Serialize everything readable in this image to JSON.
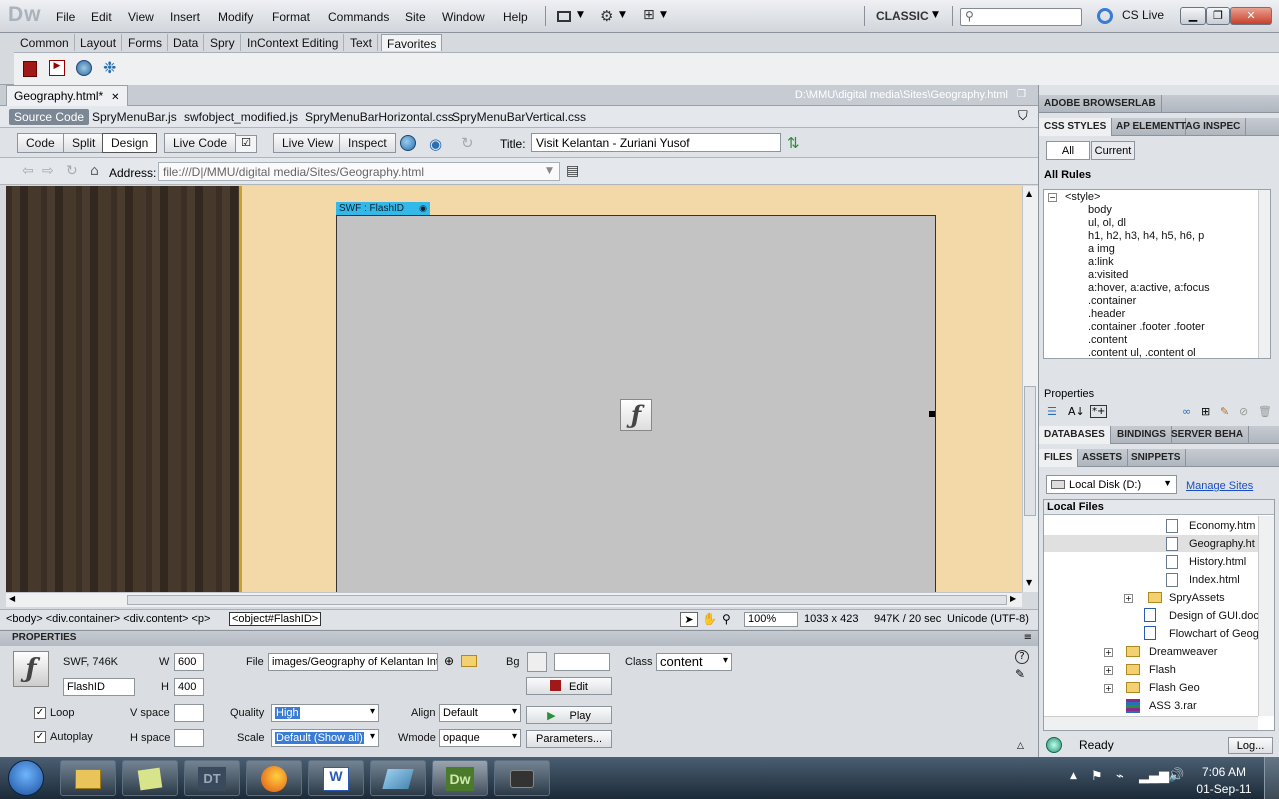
{
  "app": {
    "logo": "Dw",
    "workspace": "CLASSIC",
    "cslive": "CS Live"
  },
  "menu": [
    "File",
    "Edit",
    "View",
    "Insert",
    "Modify",
    "Format",
    "Commands",
    "Site",
    "Window",
    "Help"
  ],
  "insert_tabs": [
    "Common",
    "Layout",
    "Forms",
    "Data",
    "Spry",
    "InContext Editing",
    "Text",
    "Favorites"
  ],
  "document": {
    "tab": "Geography.html*",
    "path": "D:\\MMU\\digital media\\Sites\\Geography.html",
    "source_code": "Source Code",
    "related": [
      "SpryMenuBar.js",
      "swfobject_modified.js",
      "SpryMenuBarHorizontal.css",
      "SpryMenuBarVertical.css"
    ],
    "views": [
      "Code",
      "Split",
      "Design"
    ],
    "live_code": "Live Code",
    "live_view": "Live View",
    "inspect": "Inspect",
    "title_label": "Title:",
    "title_value": "Visit Kelantan - Zuriani Yusof",
    "address_label": "Address:",
    "address_value": "file:///D|/MMU/digital media/Sites/Geography.html",
    "swf_label": "SWF : FlashID",
    "tag_path": "<body> <div.container> <div.content> <p>",
    "selected_tag": "<object#FlashID>",
    "zoom": "100%",
    "dimensions": "1033 x 423",
    "size_time": "947K / 20 sec",
    "encoding": "Unicode (UTF-8)"
  },
  "properties": {
    "header": "PROPERTIES",
    "type": "SWF, 746K",
    "id": "FlashID",
    "w_label": "W",
    "w": "600",
    "h_label": "H",
    "h": "400",
    "file_label": "File",
    "file": "images/Geography of Kelantan Int",
    "bg_label": "Bg",
    "class_label": "Class",
    "class_value": "content",
    "edit": "Edit",
    "loop": "Loop",
    "autoplay": "Autoplay",
    "vspace": "V space",
    "hspace": "H space",
    "quality_label": "Quality",
    "quality": "High",
    "scale_label": "Scale",
    "scale": "Default (Show all)",
    "align_label": "Align",
    "align": "Default",
    "wmode_label": "Wmode",
    "wmode": "opaque",
    "play": "Play",
    "parameters": "Parameters..."
  },
  "right": {
    "browserlab": "ADOBE BROWSERLAB",
    "css_tabs": [
      "CSS STYLES",
      "AP ELEMENT",
      "TAG INSPEC"
    ],
    "all": "All",
    "current": "Current",
    "all_rules": "All Rules",
    "style_root": "<style>",
    "rules": [
      "body",
      "ul, ol, dl",
      "h1, h2, h3, h4, h5, h6, p",
      "a img",
      "a:link",
      "a:visited",
      "a:hover, a:active, a:focus",
      ".container",
      ".header",
      ".container .footer .footer",
      ".content",
      ".content ul, .content ol"
    ],
    "properties": "Properties",
    "db_tabs": [
      "DATABASES",
      "BINDINGS",
      "SERVER BEHA"
    ],
    "files_tabs": [
      "FILES",
      "ASSETS",
      "SNIPPETS"
    ],
    "disk": "Local Disk (D:)",
    "manage": "Manage Sites",
    "local_files": "Local Files",
    "files": [
      "Economy.htm",
      "Geography.ht",
      "History.html",
      "Index.html"
    ],
    "folders": [
      "SpryAssets"
    ],
    "docs": [
      "Design of GUI.doc",
      "Flowchart of Geog"
    ],
    "top_folders": [
      "Dreamweaver",
      "Flash",
      "Flash Geo"
    ],
    "rar": "ASS 3.rar",
    "ready": "Ready",
    "log": "Log..."
  },
  "taskbar": {
    "time": "7:06 AM",
    "date": "01-Sep-11",
    "dt": "DT",
    "dw": "Dw"
  }
}
